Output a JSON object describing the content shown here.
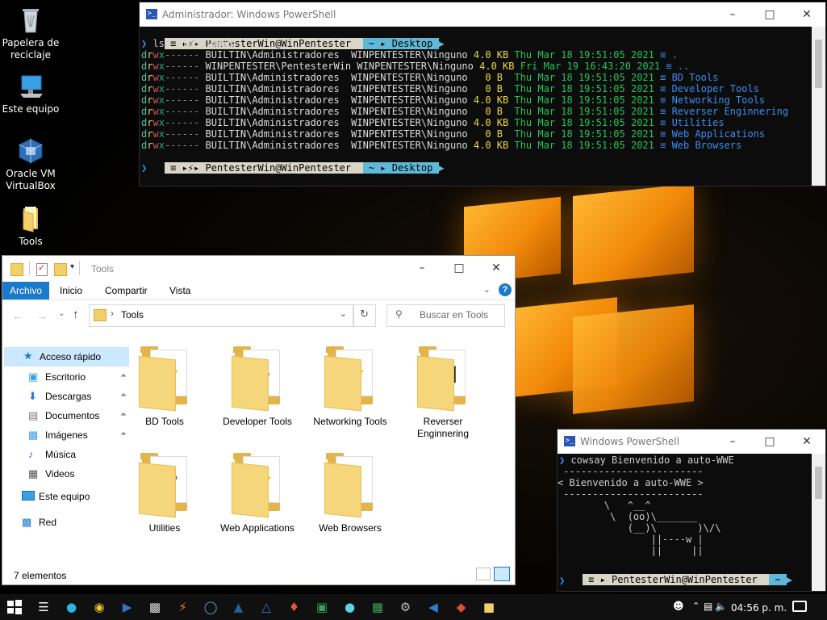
{
  "desktop": {
    "icons": [
      {
        "label": "Papelera de reciclaje",
        "icon": "recycle-bin-icon"
      },
      {
        "label": "Este equipo",
        "icon": "computer-icon"
      },
      {
        "label": "Oracle VM VirtualBox",
        "icon": "virtualbox-icon"
      },
      {
        "label": "Tools",
        "icon": "folder-icon"
      }
    ]
  },
  "ps_main": {
    "title": "Administrador: Windows PowerShell",
    "prompt": {
      "user": "PentesterWin@WinPentester",
      "home": "~",
      "dir": "Desktop"
    },
    "command": "lsd -lah Tools",
    "rows": [
      {
        "perm": "drwx------",
        "owner": "BUILTIN\\Administradores ",
        "group": "WINPENTESTER\\Ninguno",
        "size": "4.0 KB",
        "date": "Thu Mar 18 19:51:05 2021",
        "name": "."
      },
      {
        "perm": "drwx------",
        "owner": "WINPENTESTER\\PentesterWin",
        "group": "WINPENTESTER\\Ninguno",
        "size": "4.0 KB",
        "date": "Fri Mar 19 16:43:20 2021",
        "name": ".."
      },
      {
        "perm": "drwx------",
        "owner": "BUILTIN\\Administradores ",
        "group": "WINPENTESTER\\Ninguno",
        "size": "  0 B ",
        "date": "Thu Mar 18 19:51:05 2021",
        "name": "BD Tools"
      },
      {
        "perm": "drwx------",
        "owner": "BUILTIN\\Administradores ",
        "group": "WINPENTESTER\\Ninguno",
        "size": "  0 B ",
        "date": "Thu Mar 18 19:51:05 2021",
        "name": "Developer Tools"
      },
      {
        "perm": "drwx------",
        "owner": "BUILTIN\\Administradores ",
        "group": "WINPENTESTER\\Ninguno",
        "size": "4.0 KB",
        "date": "Thu Mar 18 19:51:05 2021",
        "name": "Networking Tools"
      },
      {
        "perm": "drwx------",
        "owner": "BUILTIN\\Administradores ",
        "group": "WINPENTESTER\\Ninguno",
        "size": "  0 B ",
        "date": "Thu Mar 18 19:51:05 2021",
        "name": "Reverser Enginnering"
      },
      {
        "perm": "drwx------",
        "owner": "BUILTIN\\Administradores ",
        "group": "WINPENTESTER\\Ninguno",
        "size": "4.0 KB",
        "date": "Thu Mar 18 19:51:05 2021",
        "name": "Utilities"
      },
      {
        "perm": "drwx------",
        "owner": "BUILTIN\\Administradores ",
        "group": "WINPENTESTER\\Ninguno",
        "size": "  0 B ",
        "date": "Thu Mar 18 19:51:05 2021",
        "name": "Web Applications"
      },
      {
        "perm": "drwx------",
        "owner": "BUILTIN\\Administradores ",
        "group": "WINPENTESTER\\Ninguno",
        "size": "4.0 KB",
        "date": "Thu Mar 18 19:51:05 2021",
        "name": "Web Browsers"
      }
    ]
  },
  "explorer": {
    "title": "Tools",
    "ribbon_tabs": [
      "Archivo",
      "Inicio",
      "Compartir",
      "Vista"
    ],
    "address": "Tools",
    "search_placeholder": "Buscar en Tools",
    "nav": {
      "quick_access": "Acceso rápido",
      "pinned": [
        "Escritorio",
        "Descargas",
        "Documentos",
        "Imágenes"
      ],
      "others": [
        "Música",
        "Videos"
      ],
      "this_pc": "Este equipo",
      "network": "Red"
    },
    "folders": [
      {
        "label": "BD Tools"
      },
      {
        "label": "Developer Tools"
      },
      {
        "label": "Networking Tools"
      },
      {
        "label": "Reverser Enginnering"
      },
      {
        "label": "Utilities"
      },
      {
        "label": "Web Applications"
      },
      {
        "label": "Web Browsers"
      }
    ],
    "status": "7 elementos"
  },
  "ps_small": {
    "title": "Windows PowerShell",
    "command": "cowsay Bienvenido a auto-WWE",
    "cow_lines": [
      " ------------------------ ",
      "< Bienvenido a auto-WWE >",
      " ------------------------ ",
      "        \\   ^__^",
      "         \\  (oo)\\_______",
      "            (__)\\       )\\/\\",
      "                ||----w |",
      "                ||     ||"
    ],
    "prompt": {
      "user": "PentesterWin@WinPentester",
      "home": "~"
    }
  },
  "taskbar": {
    "clock": "04:56 p. m.",
    "apps": [
      "task-view-icon",
      "edge-icon",
      "chrome-icon",
      "powershell-icon",
      "cmd-icon",
      "burp-icon",
      "wireshark-icon",
      "ghidra-icon",
      "flame-icon",
      "shield-icon",
      "notepad-icon",
      "lock-icon",
      "network-tool-icon",
      "gear-icon",
      "vscode-icon",
      "git-icon",
      "explorer-icon"
    ]
  },
  "colors": {
    "accent": "#1979ca",
    "terminal_bg": "#0c0c0c",
    "date": "#23c455",
    "name": "#3b8ef0",
    "size": "#f0d840"
  }
}
